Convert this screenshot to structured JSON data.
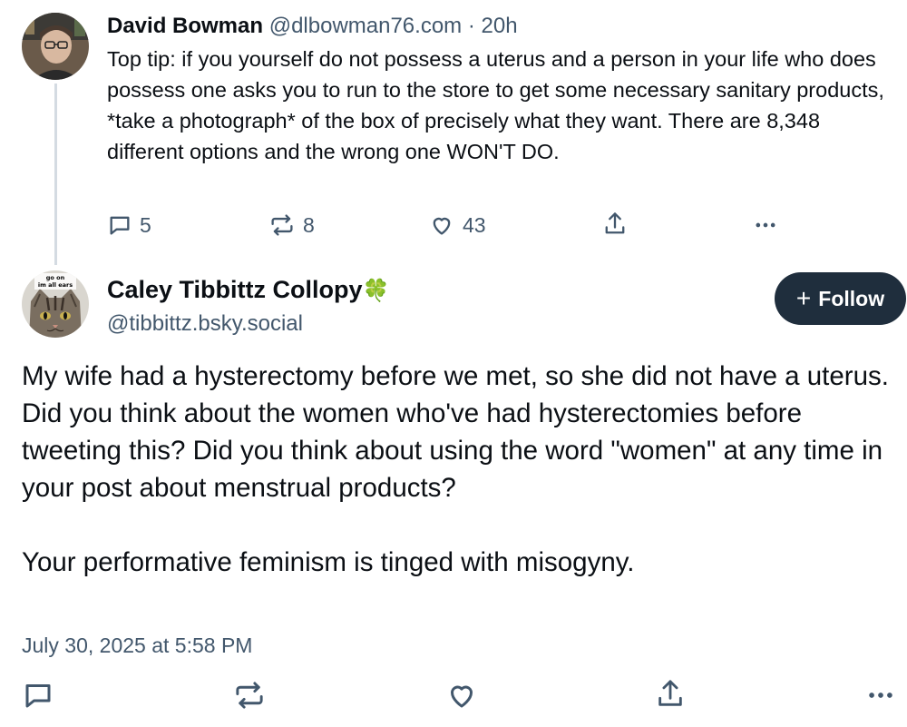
{
  "parent_post": {
    "author_name": "David Bowman",
    "author_handle": "@dlbowman76.com",
    "separator": "·",
    "time_ago": "20h",
    "text": "Top tip: if you yourself do not possess a uterus and a person in your life who does possess one asks you to run to the store to get some necessary sanitary products, *take a photograph* of the box of precisely what they want. There are 8,348 different options and the wrong one WON'T DO.",
    "counts": {
      "replies": "5",
      "reposts": "8",
      "likes": "43"
    }
  },
  "reply_post": {
    "author_name": "Caley Tibbittz Collopy",
    "name_emoji": "🍀",
    "author_handle": "@tibbittz.bsky.social",
    "avatar_caption": "go on im all ears",
    "follow_label": "Follow",
    "paragraphs": [
      "My wife had a hysterectomy before we met, so she did not have a uterus. Did you think about the women who've had hysterectomies before tweeting this? Did you think about using the word \"women\" at any time in your post about menstrual products?",
      "Your performative feminism is tinged with misogyny."
    ],
    "timestamp": "July 30, 2025 at 5:58 PM"
  },
  "colors": {
    "text": "#0b0f14",
    "muted": "#42576c",
    "follow_bg": "#1f2e3d",
    "thread_line": "#d4dbe2",
    "clover": "#2e9e4a"
  },
  "icons": [
    "reply-icon",
    "repost-icon",
    "like-icon",
    "share-icon",
    "more-icon",
    "plus-icon"
  ]
}
